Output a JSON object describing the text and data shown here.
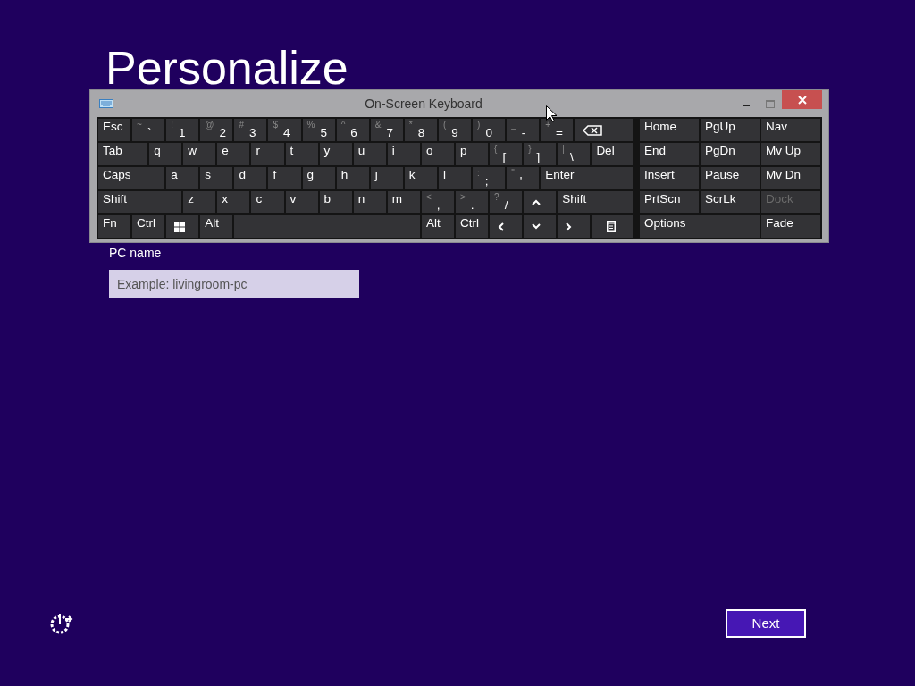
{
  "page": {
    "title": "Personalize",
    "field": {
      "label": "PC name",
      "placeholder": "Example: livingroom-pc"
    },
    "next_button": "Next"
  },
  "keyboard": {
    "title": "On-Screen Keyboard",
    "main_rows": [
      [
        {
          "kind": "text",
          "label": "Esc"
        },
        {
          "kind": "text",
          "shift": "~",
          "label": "`"
        },
        {
          "kind": "text",
          "shift": "!",
          "label": "1"
        },
        {
          "kind": "text",
          "shift": "@",
          "label": "2"
        },
        {
          "kind": "text",
          "shift": "#",
          "label": "3"
        },
        {
          "kind": "text",
          "shift": "$",
          "label": "4"
        },
        {
          "kind": "text",
          "shift": "%",
          "label": "5"
        },
        {
          "kind": "text",
          "shift": "^",
          "label": "6"
        },
        {
          "kind": "text",
          "shift": "&",
          "label": "7"
        },
        {
          "kind": "text",
          "shift": "*",
          "label": "8"
        },
        {
          "kind": "text",
          "shift": "(",
          "label": "9"
        },
        {
          "kind": "text",
          "shift": ")",
          "label": "0"
        },
        {
          "kind": "text",
          "shift": "_",
          "label": "-"
        },
        {
          "kind": "text",
          "shift": "+",
          "label": "="
        },
        {
          "kind": "backspace"
        }
      ],
      [
        {
          "kind": "text",
          "label": "Tab"
        },
        {
          "kind": "text",
          "label": "q"
        },
        {
          "kind": "text",
          "label": "w"
        },
        {
          "kind": "text",
          "label": "e"
        },
        {
          "kind": "text",
          "label": "r"
        },
        {
          "kind": "text",
          "label": "t"
        },
        {
          "kind": "text",
          "label": "y"
        },
        {
          "kind": "text",
          "label": "u"
        },
        {
          "kind": "text",
          "label": "i"
        },
        {
          "kind": "text",
          "label": "o"
        },
        {
          "kind": "text",
          "label": "p"
        },
        {
          "kind": "text",
          "shift": "{",
          "label": "["
        },
        {
          "kind": "text",
          "shift": "}",
          "label": "]"
        },
        {
          "kind": "text",
          "shift": "|",
          "label": "\\"
        },
        {
          "kind": "text",
          "label": "Del"
        }
      ],
      [
        {
          "kind": "text",
          "label": "Caps"
        },
        {
          "kind": "text",
          "label": "a"
        },
        {
          "kind": "text",
          "label": "s"
        },
        {
          "kind": "text",
          "label": "d"
        },
        {
          "kind": "text",
          "label": "f"
        },
        {
          "kind": "text",
          "label": "g"
        },
        {
          "kind": "text",
          "label": "h"
        },
        {
          "kind": "text",
          "label": "j"
        },
        {
          "kind": "text",
          "label": "k"
        },
        {
          "kind": "text",
          "label": "l"
        },
        {
          "kind": "text",
          "shift": ":",
          "label": ";"
        },
        {
          "kind": "text",
          "shift": "\"",
          "label": "'"
        },
        {
          "kind": "text",
          "label": "Enter"
        }
      ],
      [
        {
          "kind": "text",
          "label": "Shift"
        },
        {
          "kind": "text",
          "label": "z"
        },
        {
          "kind": "text",
          "label": "x"
        },
        {
          "kind": "text",
          "label": "c"
        },
        {
          "kind": "text",
          "label": "v"
        },
        {
          "kind": "text",
          "label": "b"
        },
        {
          "kind": "text",
          "label": "n"
        },
        {
          "kind": "text",
          "label": "m"
        },
        {
          "kind": "text",
          "shift": "<",
          "label": ","
        },
        {
          "kind": "text",
          "shift": ">",
          "label": "."
        },
        {
          "kind": "text",
          "shift": "?",
          "label": "/"
        },
        {
          "kind": "up"
        },
        {
          "kind": "text",
          "label": "Shift"
        }
      ],
      [
        {
          "kind": "text",
          "label": "Fn"
        },
        {
          "kind": "text",
          "label": "Ctrl"
        },
        {
          "kind": "windows"
        },
        {
          "kind": "text",
          "label": "Alt"
        },
        {
          "kind": "space"
        },
        {
          "kind": "text",
          "label": "Alt"
        },
        {
          "kind": "text",
          "label": "Ctrl"
        },
        {
          "kind": "left"
        },
        {
          "kind": "down"
        },
        {
          "kind": "right"
        },
        {
          "kind": "menu"
        }
      ]
    ],
    "side_rows": [
      [
        {
          "label": "Home",
          "disabled": false
        },
        {
          "label": "PgUp",
          "disabled": false
        },
        {
          "label": "Nav",
          "disabled": false
        }
      ],
      [
        {
          "label": "End",
          "disabled": false
        },
        {
          "label": "PgDn",
          "disabled": false
        },
        {
          "label": "Mv Up",
          "disabled": false
        }
      ],
      [
        {
          "label": "Insert",
          "disabled": false
        },
        {
          "label": "Pause",
          "disabled": false
        },
        {
          "label": "Mv Dn",
          "disabled": false
        }
      ],
      [
        {
          "label": "PrtScn",
          "disabled": false
        },
        {
          "label": "ScrLk",
          "disabled": false
        },
        {
          "label": "Dock",
          "disabled": true
        }
      ],
      [
        {
          "label": "Options",
          "disabled": false
        },
        {
          "label": "Fade",
          "disabled": false
        }
      ]
    ]
  }
}
